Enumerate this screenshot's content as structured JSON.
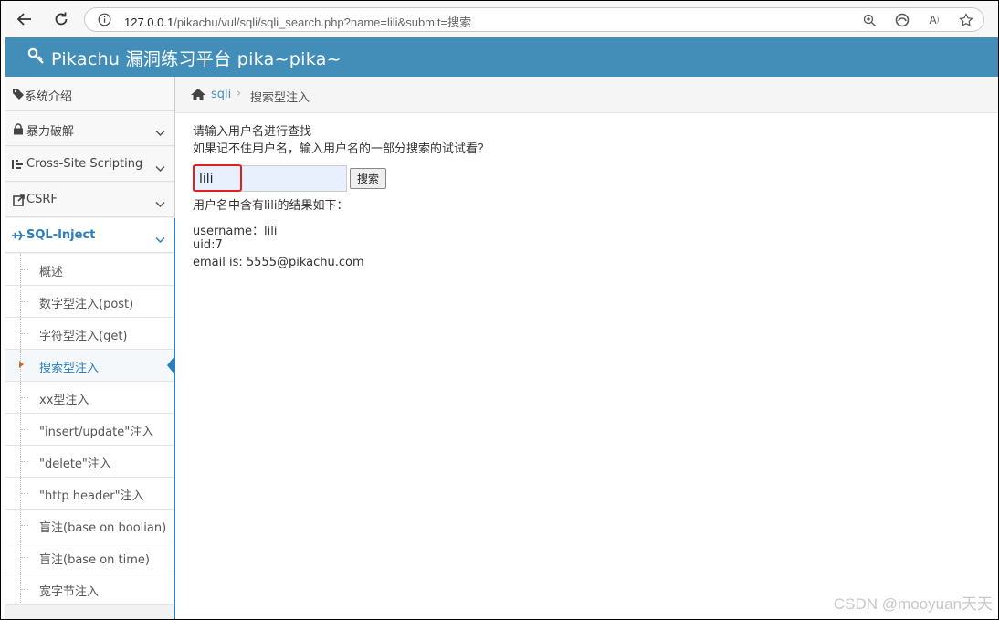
{
  "browser": {
    "url_host": "127.0.0.1",
    "url_path": "/pikachu/vul/sqli/sqli_search.php?name=lili&submit=搜索"
  },
  "header": {
    "title": "Pikachu 漏洞练习平台 pika~pika~"
  },
  "sidebar": {
    "items": [
      {
        "label": "系统介绍",
        "icon": "tags-icon"
      },
      {
        "label": "暴力破解",
        "icon": "lock-icon"
      },
      {
        "label": "Cross-Site Scripting",
        "icon": "list-icon"
      },
      {
        "label": "CSRF",
        "icon": "share-icon"
      },
      {
        "label": "SQL-Inject",
        "icon": "plane-icon"
      }
    ],
    "sub_items": [
      {
        "label": "概述"
      },
      {
        "label": "数字型注入(post)"
      },
      {
        "label": "字符型注入(get)"
      },
      {
        "label": "搜索型注入"
      },
      {
        "label": "xx型注入"
      },
      {
        "label": "\"insert/update\"注入"
      },
      {
        "label": "\"delete\"注入"
      },
      {
        "label": "\"http header\"注入"
      },
      {
        "label": "盲注(base on boolian)"
      },
      {
        "label": "盲注(base on time)"
      },
      {
        "label": "宽字节注入"
      }
    ]
  },
  "breadcrumb": {
    "link": "sqli",
    "current": "搜索型注入"
  },
  "main": {
    "prompt1": "请输入用户名进行查找",
    "prompt2": "如果记不住用户名，输入用户名的一部分搜索的试试看？",
    "search_value": "lili",
    "search_button": "搜索",
    "result_heading": "用户名中含有lili的结果如下：",
    "result_username": "username：lili",
    "result_uid": "uid:7",
    "result_email": "email is: 5555@pikachu.com"
  },
  "watermark": "CSDN @mooyuan天天",
  "colors": {
    "header_bg": "#438eb9",
    "active_link": "#2b7dbc",
    "highlight_box": "#e02020"
  }
}
